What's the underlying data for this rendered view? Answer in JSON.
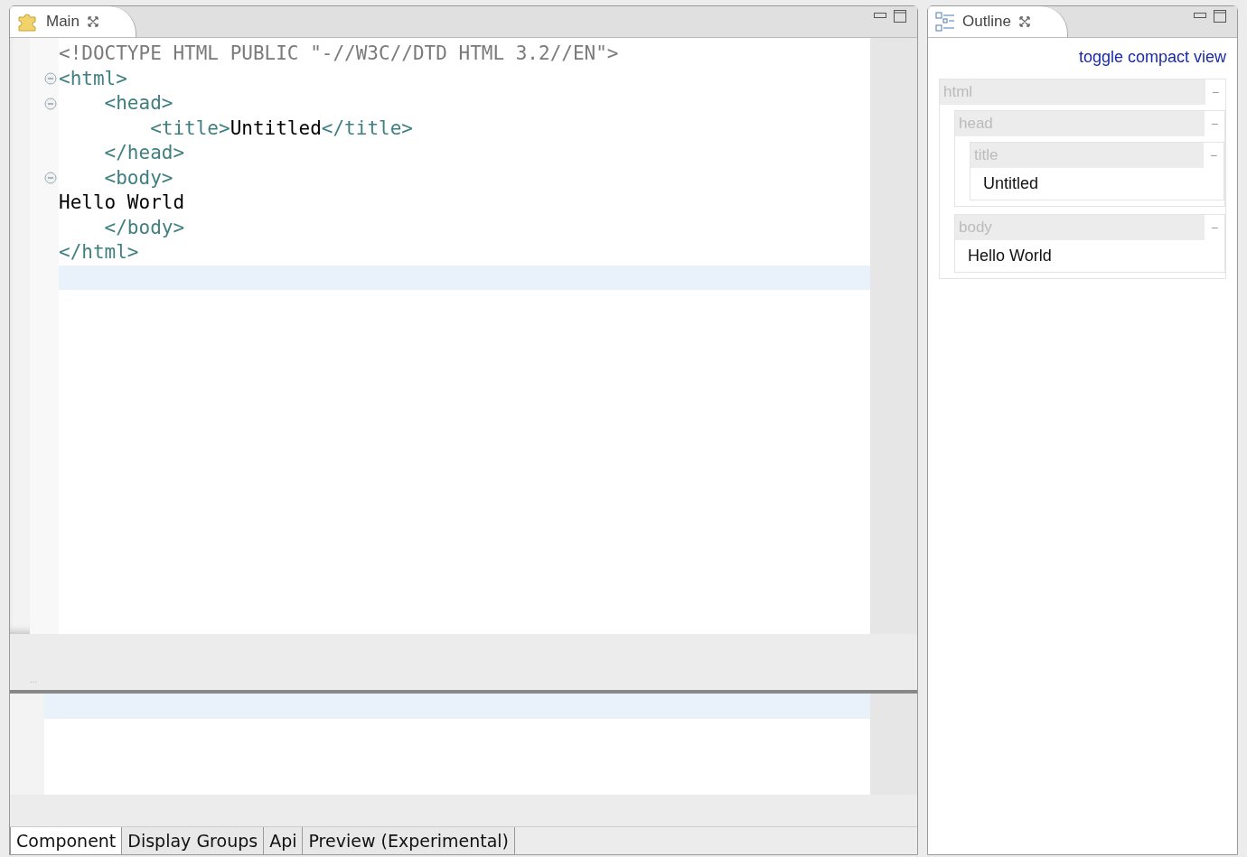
{
  "editor_tab": {
    "label": "Main",
    "selected": true
  },
  "editor": {
    "lines": [
      {
        "fold": false,
        "current": false,
        "segments": [
          {
            "kind": "doctype",
            "text": "<!DOCTYPE HTML PUBLIC \"-//W3C//DTD HTML 3.2//EN\">"
          }
        ]
      },
      {
        "fold": true,
        "current": false,
        "segments": [
          {
            "kind": "tag",
            "text": "<html>"
          }
        ]
      },
      {
        "fold": true,
        "current": false,
        "segments": [
          {
            "kind": "tag",
            "text": "    <head>"
          }
        ]
      },
      {
        "fold": false,
        "current": false,
        "segments": [
          {
            "kind": "tag",
            "text": "        <title>"
          },
          {
            "kind": "text",
            "text": "Untitled"
          },
          {
            "kind": "tag",
            "text": "</title>"
          }
        ]
      },
      {
        "fold": false,
        "current": false,
        "segments": [
          {
            "kind": "tag",
            "text": "    </head>"
          }
        ]
      },
      {
        "fold": true,
        "current": false,
        "segments": [
          {
            "kind": "tag",
            "text": "    <body>"
          }
        ]
      },
      {
        "fold": false,
        "current": false,
        "segments": [
          {
            "kind": "text",
            "text": "Hello World"
          }
        ]
      },
      {
        "fold": false,
        "current": false,
        "segments": [
          {
            "kind": "tag",
            "text": "    </body>"
          }
        ]
      },
      {
        "fold": false,
        "current": false,
        "segments": [
          {
            "kind": "tag",
            "text": "</html>"
          }
        ]
      },
      {
        "fold": false,
        "current": true
      }
    ]
  },
  "sash_label": "...",
  "bottom_tabs": [
    {
      "label": "Component",
      "selected": true
    },
    {
      "label": "Display Groups",
      "selected": false
    },
    {
      "label": "Api",
      "selected": false
    },
    {
      "label": "Preview (Experimental)",
      "selected": false
    }
  ],
  "outline": {
    "tab": {
      "label": "Outline",
      "selected": true
    },
    "toggle_link": "toggle compact view",
    "nodes": [
      {
        "name": "html",
        "toggle": "−",
        "expanded": true,
        "children": [
          {
            "name": "head",
            "toggle": "−",
            "expanded": true,
            "children": [
              {
                "name": "title",
                "toggle": "−",
                "expanded": true,
                "content": "Untitled"
              }
            ]
          },
          {
            "name": "body",
            "toggle": "−",
            "expanded": true,
            "content": "Hello World"
          }
        ]
      }
    ]
  }
}
